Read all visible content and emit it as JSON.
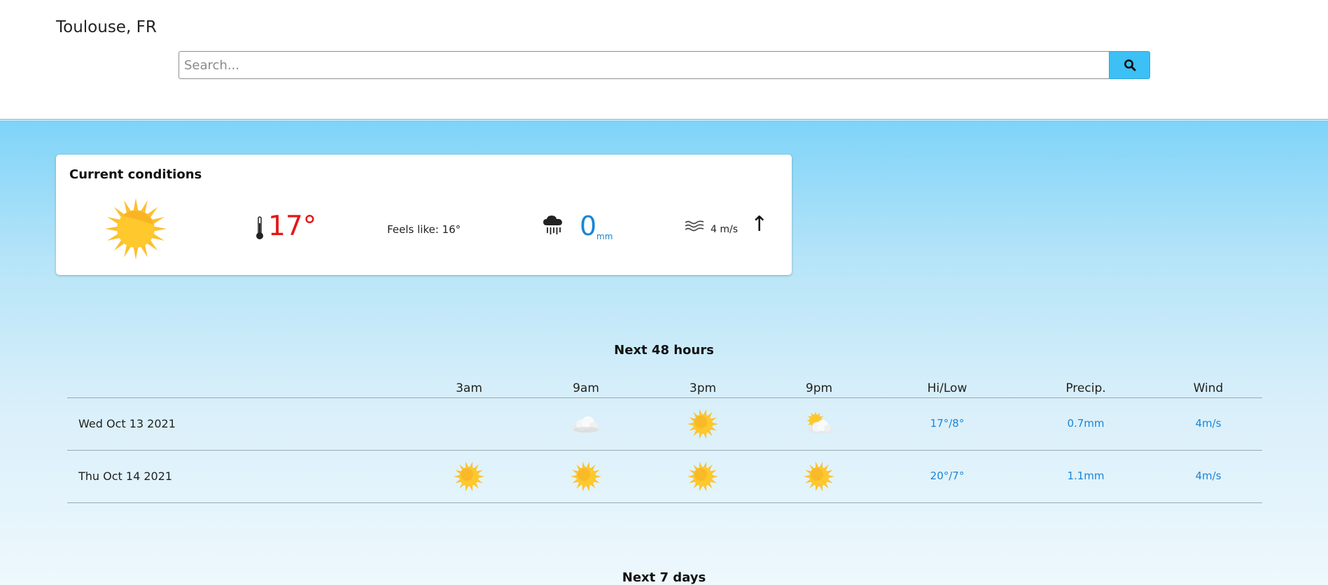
{
  "header": {
    "city": "Toulouse, FR",
    "search_placeholder": "Search...",
    "search_value": ""
  },
  "current": {
    "title": "Current conditions",
    "icon": "sun-icon",
    "temperature": "17°",
    "feels_like": "Feels like: 16°",
    "precip_value": "0",
    "precip_unit": "mm",
    "wind_speed": "4 m/s",
    "wind_arrow": "↑"
  },
  "hourly": {
    "title": "Next 48 hours",
    "columns": [
      "3am",
      "9am",
      "3pm",
      "9pm",
      "Hi/Low",
      "Precip.",
      "Wind"
    ],
    "rows": [
      {
        "date": "Wed Oct 13 2021",
        "icons": [
          "",
          "cloud-icon",
          "sun-icon",
          "partly-cloudy-icon"
        ],
        "hilow": "17°/8°",
        "precip": "0.7mm",
        "wind": "4m/s"
      },
      {
        "date": "Thu Oct 14 2021",
        "icons": [
          "sun-icon",
          "sun-icon",
          "sun-icon",
          "sun-icon"
        ],
        "hilow": "20°/7°",
        "precip": "1.1mm",
        "wind": "4m/s"
      }
    ]
  },
  "daily": {
    "title": "Next 7 days"
  },
  "colors": {
    "search_button": "#3cc0f5",
    "temp": "#e51616",
    "accent_blue": "#1a85d6",
    "sky_top": "#7ed3f8",
    "sun": "#fbc02d"
  }
}
